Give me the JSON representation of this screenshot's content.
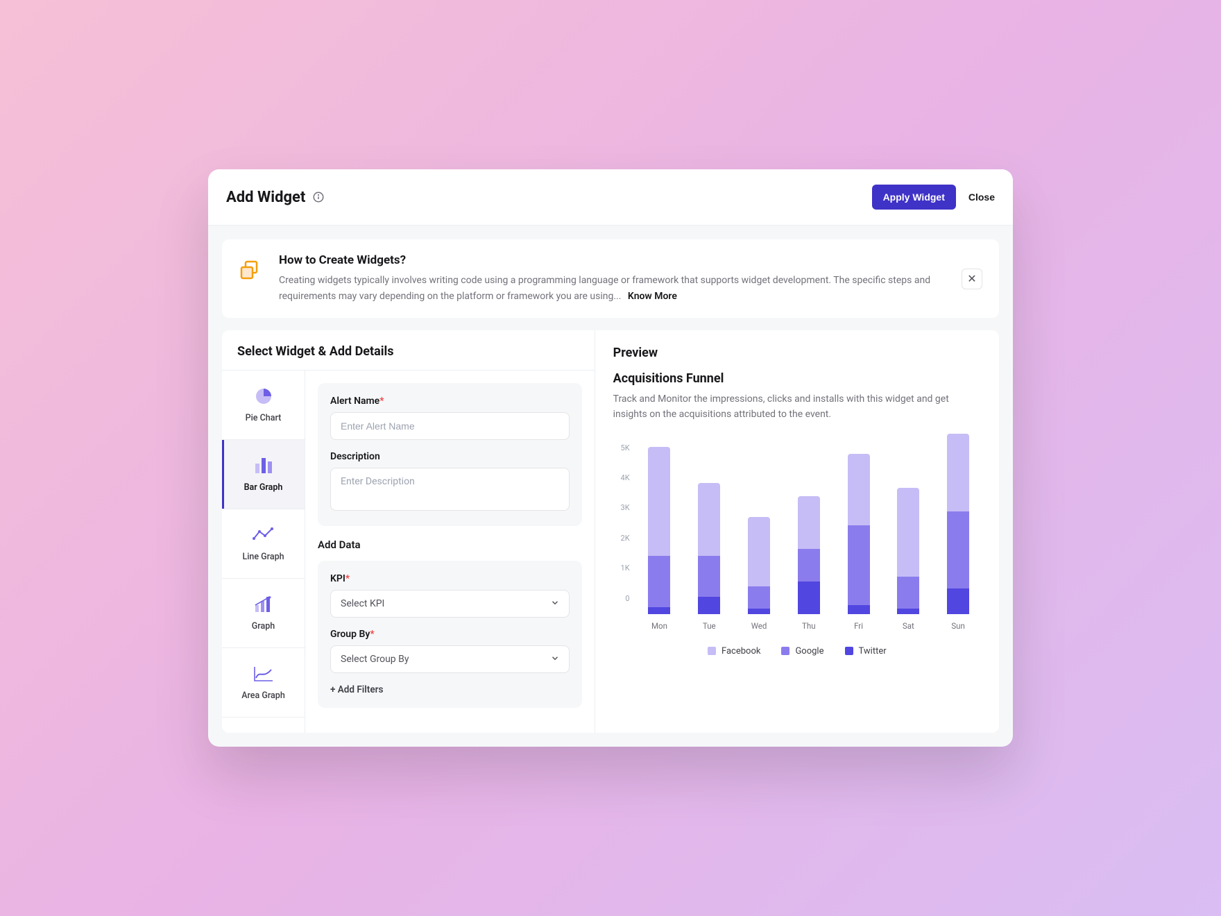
{
  "header": {
    "title": "Add Widget",
    "apply_label": "Apply Widget",
    "close_label": "Close"
  },
  "help": {
    "title": "How to Create Widgets?",
    "body": "Creating widgets typically involves writing code using a programming language or framework that supports widget development. The specific steps and requirements may vary depending on the platform or framework you are using...",
    "know_more": "Know More"
  },
  "left": {
    "heading": "Select Widget & Add Details",
    "types": [
      {
        "label": "Pie Chart"
      },
      {
        "label": "Bar Graph"
      },
      {
        "label": "Line Graph"
      },
      {
        "label": "Graph"
      },
      {
        "label": "Area Graph"
      }
    ],
    "form": {
      "alert_name_label": "Alert Name",
      "alert_name_placeholder": "Enter Alert Name",
      "description_label": "Description",
      "description_placeholder": "Enter Description",
      "add_data_heading": "Add Data",
      "kpi_label": "KPI",
      "kpi_placeholder": "Select KPI",
      "groupby_label": "Group By",
      "groupby_placeholder": "Select Group By",
      "add_filters": "+ Add Filters"
    }
  },
  "preview": {
    "heading": "Preview",
    "chart_title": "Acquisitions Funnel",
    "chart_desc": "Track and Monitor the impressions, clicks and installs with this widget and get insights on the acquisitions attributed to the event.",
    "legend": {
      "fb": "Facebook",
      "go": "Google",
      "tw": "Twitter"
    }
  },
  "chart_data": {
    "type": "bar",
    "stacked": true,
    "categories": [
      "Mon",
      "Tue",
      "Wed",
      "Thu",
      "Fri",
      "Sat",
      "Sun"
    ],
    "series": [
      {
        "name": "Twitter",
        "key": "tw",
        "color": "#5146e0",
        "values": [
          200,
          500,
          150,
          950,
          250,
          150,
          750
        ]
      },
      {
        "name": "Google",
        "key": "go",
        "color": "#8b7ced",
        "values": [
          1500,
          1200,
          650,
          950,
          2350,
          950,
          2250
        ]
      },
      {
        "name": "Facebook",
        "key": "fb",
        "color": "#c6bdf6",
        "values": [
          3200,
          2150,
          2050,
          1550,
          2100,
          2600,
          2300
        ]
      }
    ],
    "y_ticks": [
      "5K",
      "4K",
      "3K",
      "2K",
      "1K",
      "0"
    ],
    "ylim": [
      0,
      5500
    ],
    "xlabel": "",
    "ylabel": ""
  }
}
